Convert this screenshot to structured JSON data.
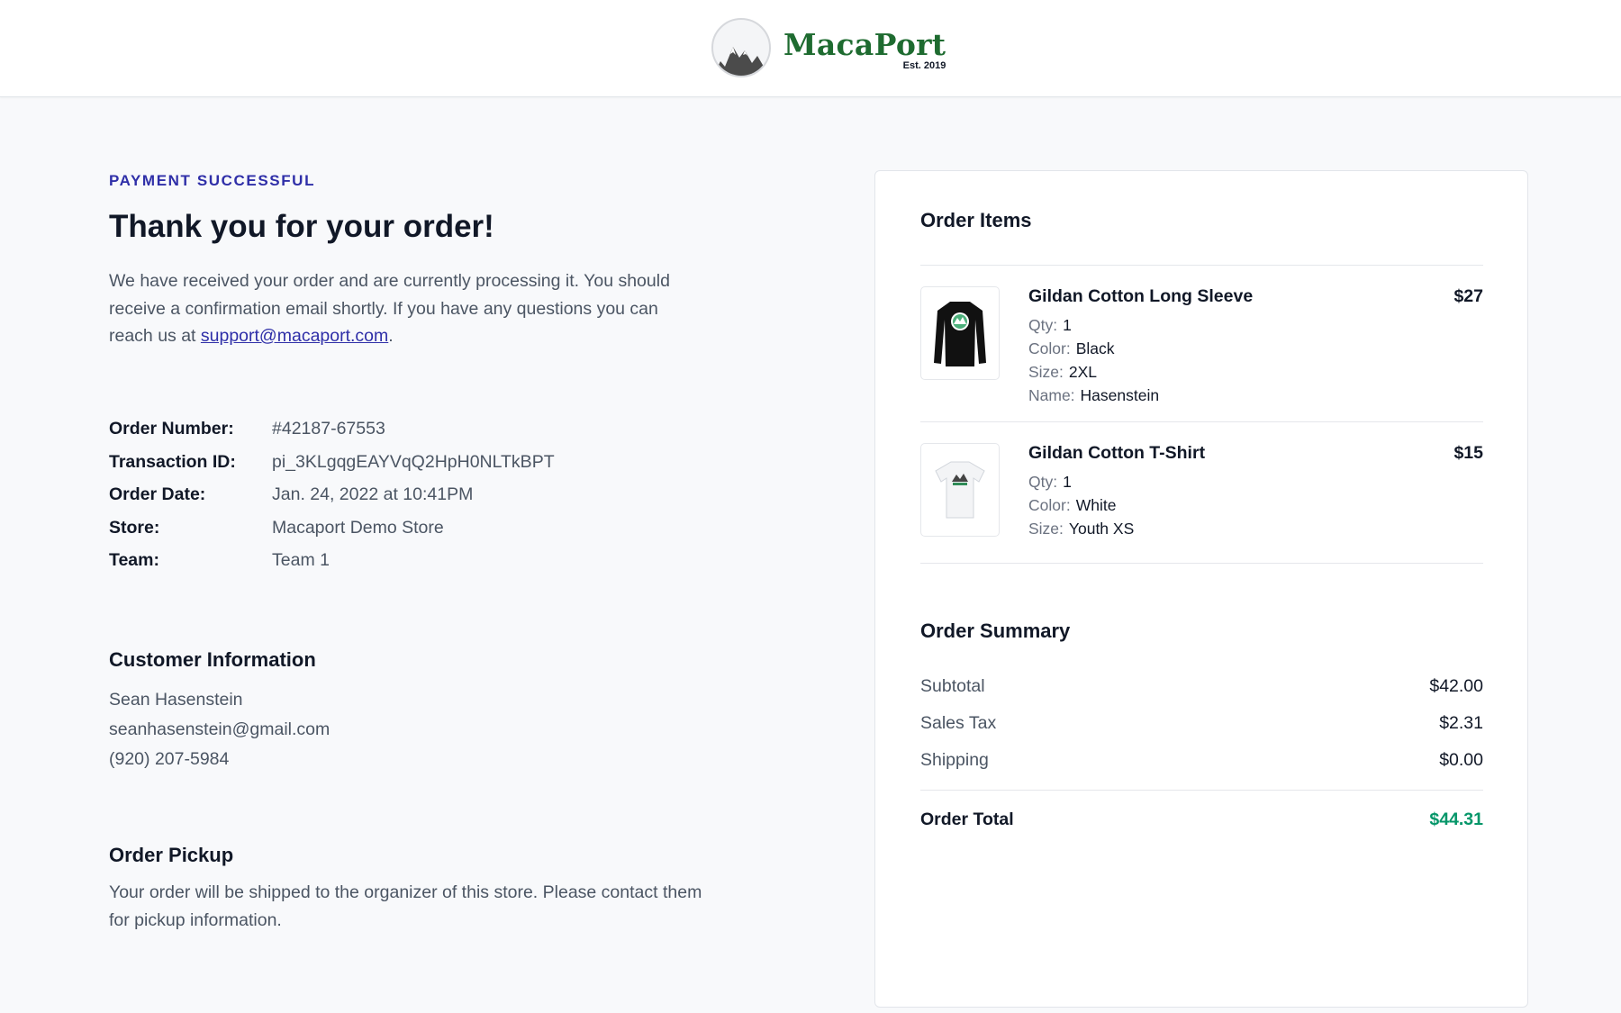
{
  "header": {
    "logo_name": "MacaPort",
    "logo_est": "Est. 2019"
  },
  "confirmation": {
    "eyebrow": "PAYMENT SUCCESSFUL",
    "title": "Thank you for your order!",
    "intro_text": "We have received your order and are currently processing it. You should receive a confirmation email shortly. If you have any questions you can reach us at ",
    "support_email": "support@macaport.com",
    "intro_end": "."
  },
  "details": [
    {
      "label": "Order Number:",
      "value": "#42187-67553"
    },
    {
      "label": "Transaction ID:",
      "value": "pi_3KLgqgEAYVqQ2HpH0NLTkBPT"
    },
    {
      "label": "Order Date:",
      "value": "Jan. 24, 2022 at 10:41PM"
    },
    {
      "label": "Store:",
      "value": "Macaport Demo Store"
    },
    {
      "label": "Team:",
      "value": "Team 1"
    }
  ],
  "customer": {
    "heading": "Customer Information",
    "name": "Sean Hasenstein",
    "email": "seanhasenstein@gmail.com",
    "phone": "(920) 207-5984"
  },
  "pickup": {
    "heading": "Order Pickup",
    "text": "Your order will be shipped to the organizer of this store. Please contact them for pickup information."
  },
  "order_items": {
    "heading": "Order Items",
    "items": [
      {
        "name": "Gildan Cotton Long Sleeve",
        "price": "$27",
        "image_icon": "black-long-sleeve-shirt",
        "attrs": [
          {
            "label": "Qty:",
            "value": "1"
          },
          {
            "label": "Color:",
            "value": "Black"
          },
          {
            "label": "Size:",
            "value": "2XL"
          },
          {
            "label": "Name:",
            "value": "Hasenstein"
          }
        ]
      },
      {
        "name": "Gildan Cotton T-Shirt",
        "price": "$15",
        "image_icon": "white-t-shirt",
        "attrs": [
          {
            "label": "Qty:",
            "value": "1"
          },
          {
            "label": "Color:",
            "value": "White"
          },
          {
            "label": "Size:",
            "value": "Youth XS"
          }
        ]
      }
    ]
  },
  "summary": {
    "heading": "Order Summary",
    "rows": [
      {
        "label": "Subtotal",
        "value": "$42.00"
      },
      {
        "label": "Sales Tax",
        "value": "$2.31"
      },
      {
        "label": "Shipping",
        "value": "$0.00"
      }
    ],
    "total_label": "Order Total",
    "total_value": "$44.31"
  },
  "colors": {
    "accent": "#2f2fa8",
    "brand_green": "#1e6b30",
    "total_green": "#059669"
  }
}
